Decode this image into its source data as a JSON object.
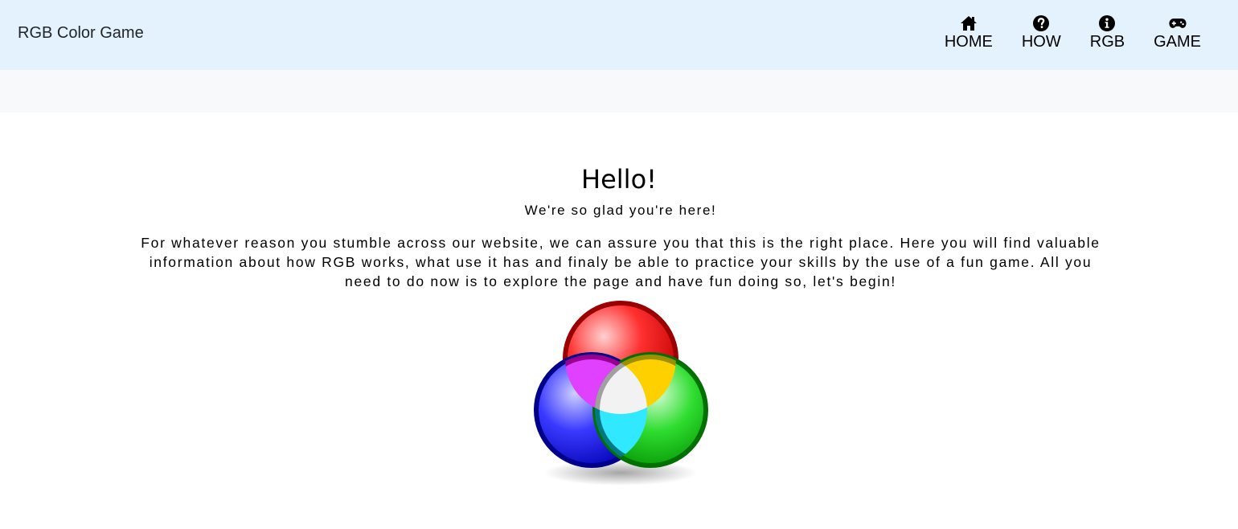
{
  "navbar": {
    "brand": "RGB Color Game",
    "items": [
      {
        "label": "HOME",
        "icon": "home-icon"
      },
      {
        "label": "HOW",
        "icon": "question-circle-icon"
      },
      {
        "label": "RGB",
        "icon": "info-circle-icon"
      },
      {
        "label": "GAME",
        "icon": "gamepad-icon"
      }
    ]
  },
  "main": {
    "title": "Hello!",
    "subtitle": "We're so glad you're here!",
    "intro": "For whatever reason you stumble across our website, we can assure you that this is the right place. Here you will find valuable information about how RGB works, what use it has and finaly be able to practice your skills by the use of a fun game. All you need to do now is to explore the page and have fun doing so, let's begin!",
    "graphic": "rgb-venn-circles-image"
  },
  "colors": {
    "navbar_bg": "#e3f2fd",
    "subbar_bg": "#f8f9fa",
    "red": "#e00000",
    "green": "#22c422",
    "blue": "#1a1acc"
  }
}
